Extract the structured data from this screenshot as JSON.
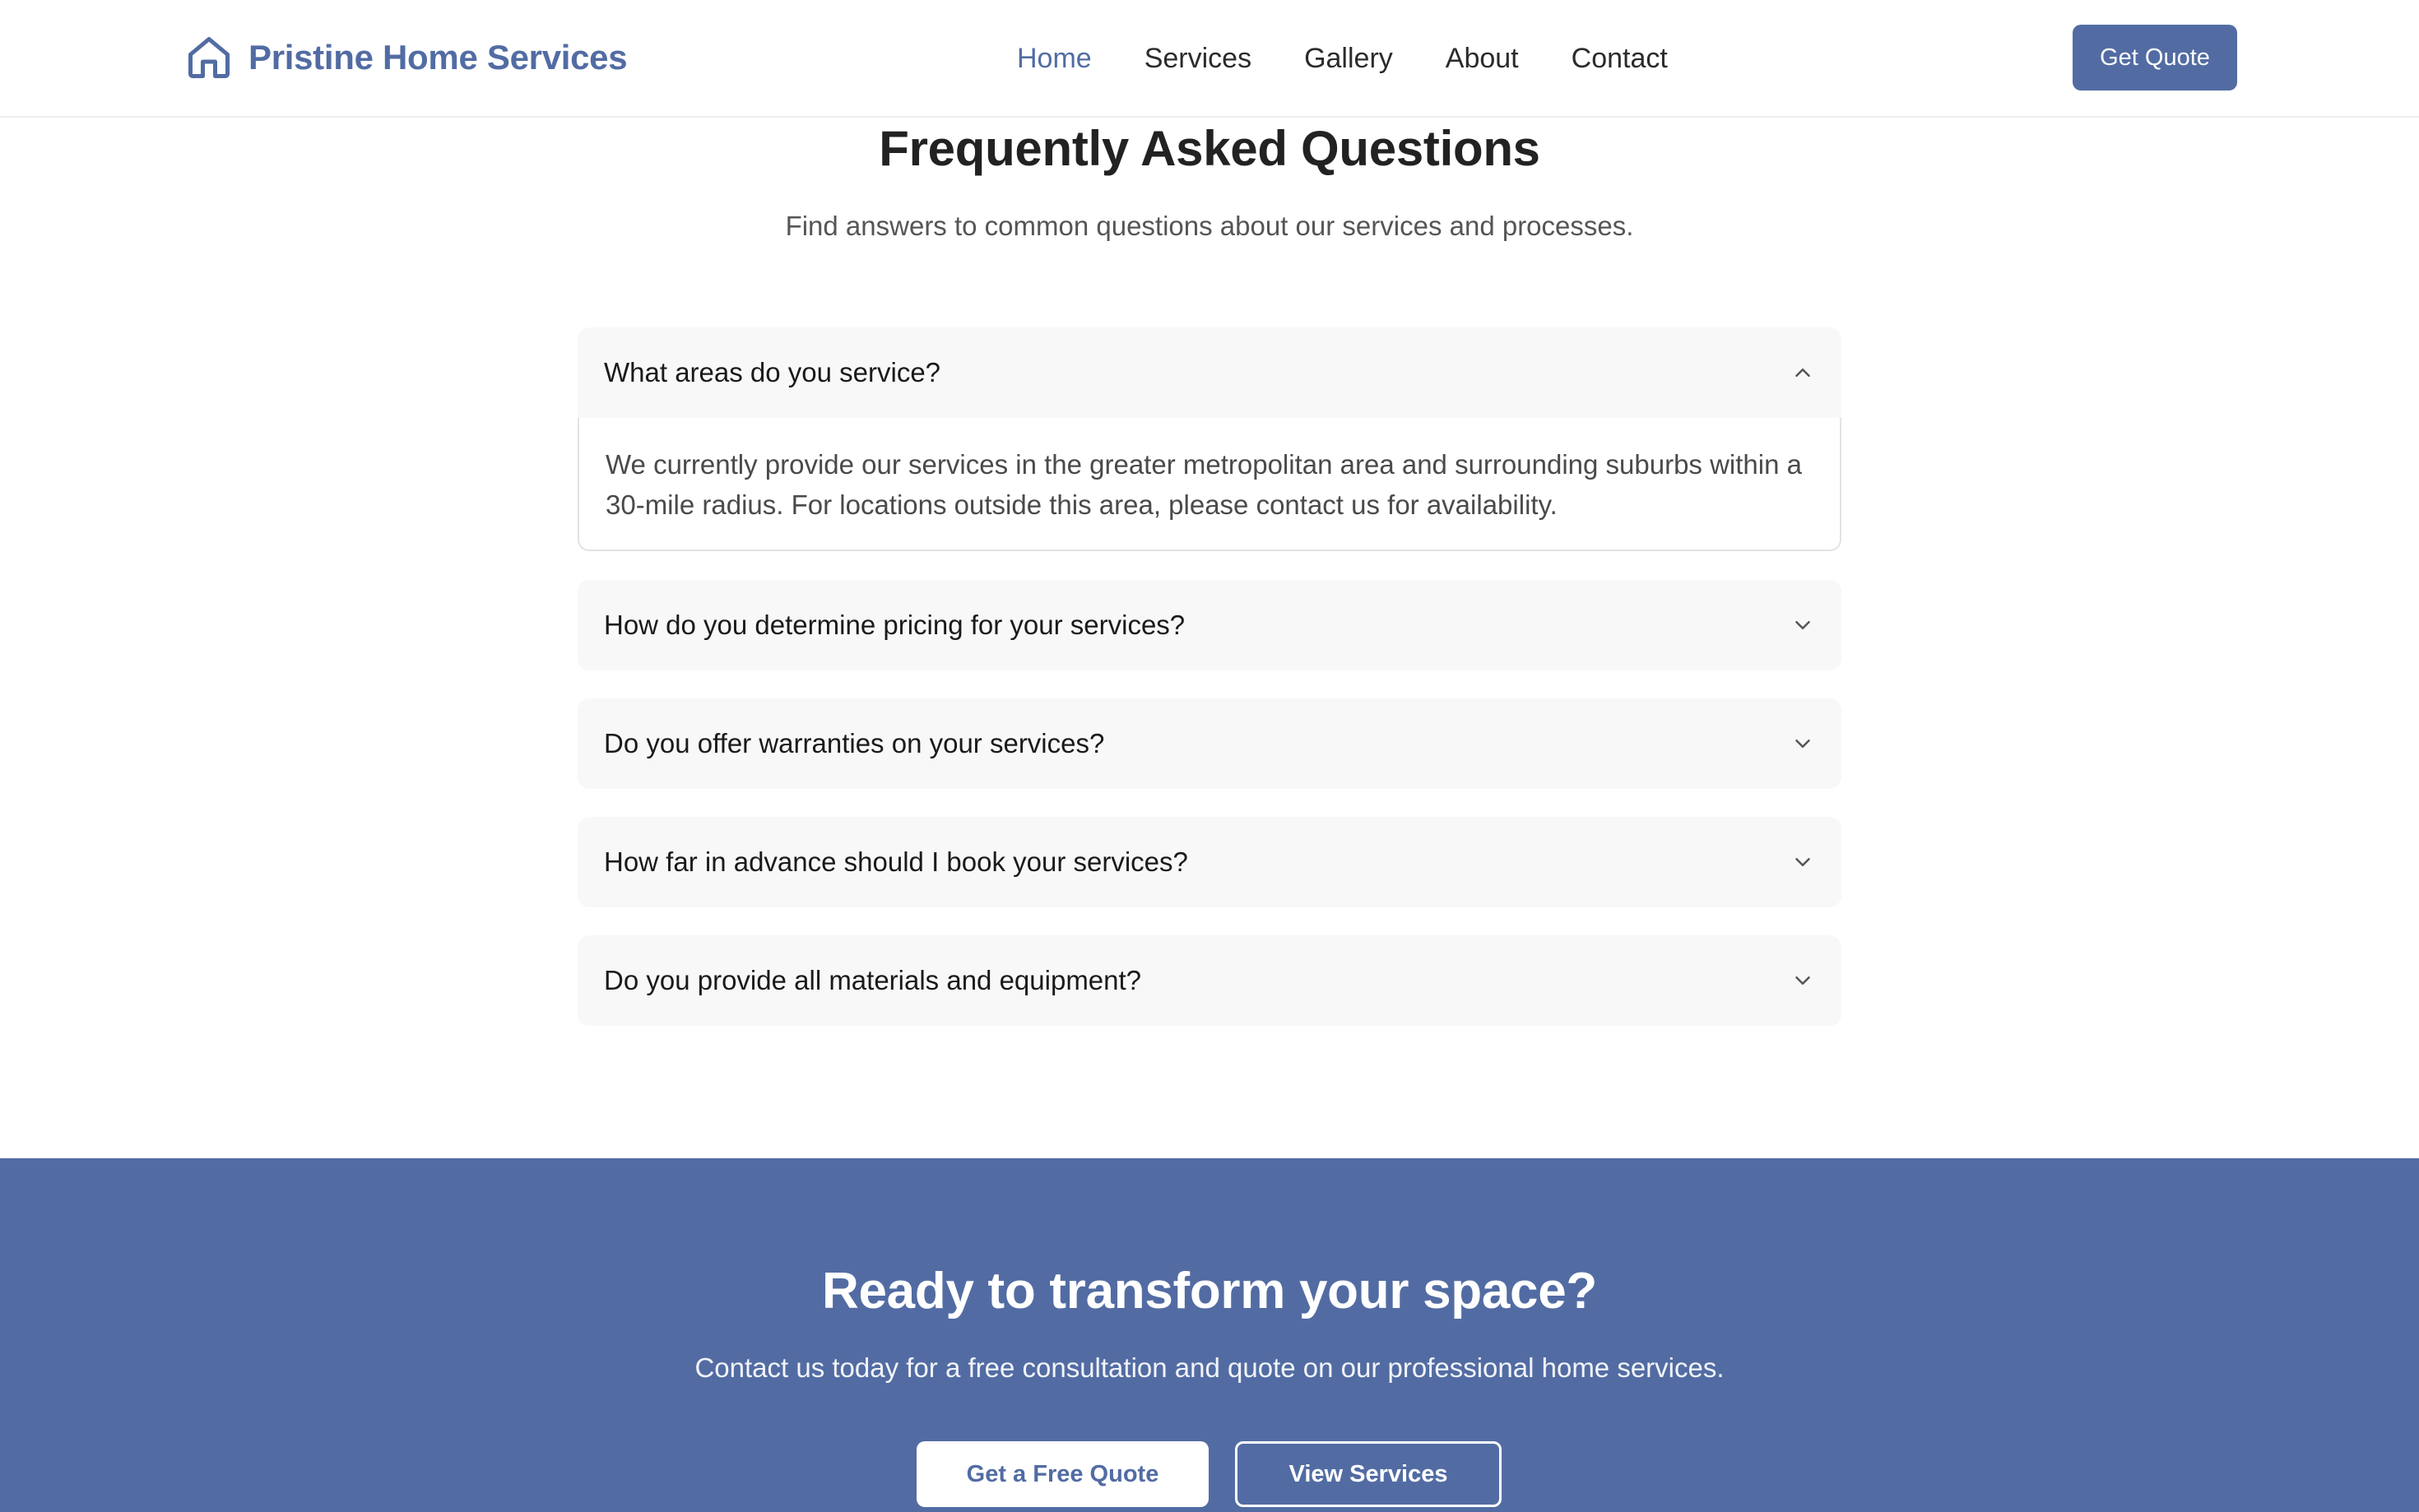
{
  "header": {
    "brand_name": "Pristine Home Services",
    "logo_icon": "home-icon",
    "nav": [
      {
        "label": "Home",
        "active": true
      },
      {
        "label": "Services",
        "active": false
      },
      {
        "label": "Gallery",
        "active": false
      },
      {
        "label": "About",
        "active": false
      },
      {
        "label": "Contact",
        "active": false
      }
    ],
    "quote_button": "Get Quote"
  },
  "faq": {
    "title": "Frequently Asked Questions",
    "subtitle": "Find answers to common questions about our services and processes.",
    "items": [
      {
        "question": "What areas do you service?",
        "answer": "We currently provide our services in the greater metropolitan area and surrounding suburbs within a 30-mile radius. For locations outside this area, please contact us for availability.",
        "expanded": true,
        "icon": "chevron-up-icon"
      },
      {
        "question": "How do you determine pricing for your services?",
        "expanded": false,
        "icon": "chevron-down-icon"
      },
      {
        "question": "Do you offer warranties on your services?",
        "expanded": false,
        "icon": "chevron-down-icon"
      },
      {
        "question": "How far in advance should I book your services?",
        "expanded": false,
        "icon": "chevron-down-icon"
      },
      {
        "question": "Do you provide all materials and equipment?",
        "expanded": false,
        "icon": "chevron-down-icon"
      }
    ]
  },
  "cta": {
    "title": "Ready to transform your space?",
    "subtitle": "Contact us today for a free consultation and quote on our professional home services.",
    "primary_button": "Get a Free Quote",
    "secondary_button": "View Services"
  },
  "colors": {
    "brand": "#526ca3",
    "text": "#222222",
    "muted": "#555555",
    "faq_bg": "#f8f8f8",
    "cta_bg": "#526ca3"
  }
}
